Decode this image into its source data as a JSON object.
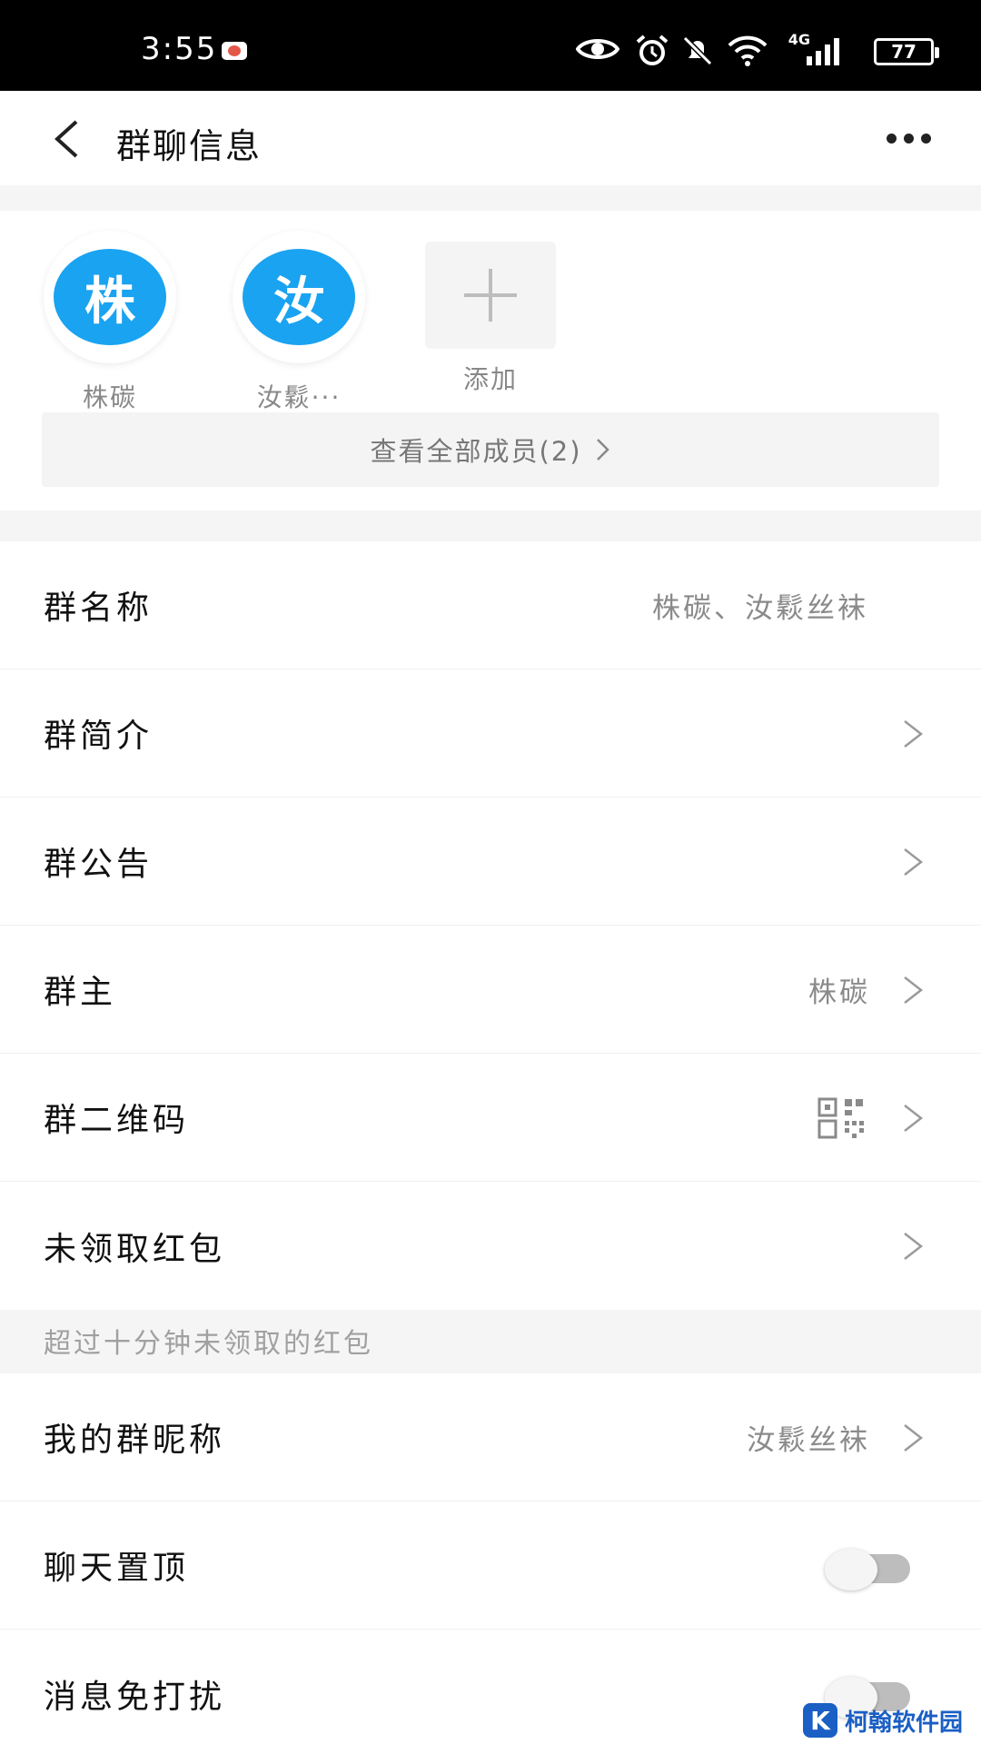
{
  "status_bar": {
    "time": "3:55",
    "network": "4G",
    "battery": "77"
  },
  "header": {
    "title": "群聊信息"
  },
  "members": {
    "items": [
      {
        "avatar_char": "株",
        "name": "株碳"
      },
      {
        "avatar_char": "汝",
        "name": "汝鬏···"
      }
    ],
    "add_label": "添加",
    "view_all_label": "查看全部成员(2)"
  },
  "settings": {
    "group_name_label": "群名称",
    "group_name_value": "株碳、汝鬏丝袜",
    "intro_label": "群简介",
    "notice_label": "群公告",
    "owner_label": "群主",
    "owner_value": "株碳",
    "qrcode_label": "群二维码",
    "red_packet_label": "未领取红包",
    "red_packet_hint": "超过十分钟未领取的红包",
    "nickname_label": "我的群昵称",
    "nickname_value": "汝鬏丝袜",
    "pin_label": "聊天置顶",
    "dnd_label": "消息免打扰"
  },
  "watermark": {
    "logo_char": "K",
    "text": "柯翰软件园"
  },
  "colors": {
    "avatar_bg": "#1aa3f0",
    "status_bar_bg": "#000000",
    "watermark": "#1a5fc4"
  }
}
